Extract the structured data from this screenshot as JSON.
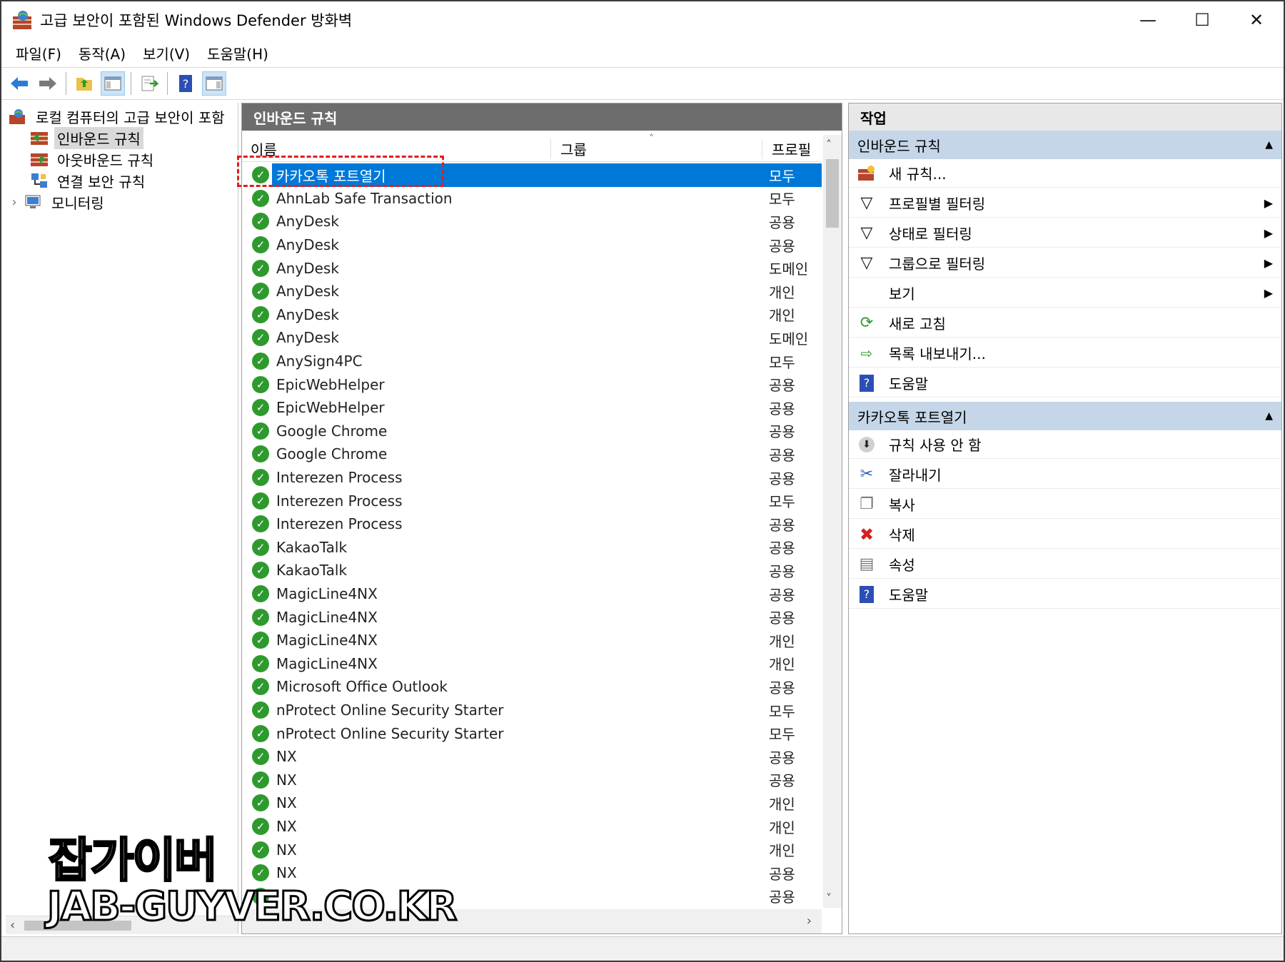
{
  "window": {
    "title": "고급 보안이 포함된 Windows Defender 방화벽",
    "minimize_glyph": "—",
    "maximize_glyph": "☐",
    "close_glyph": "✕"
  },
  "menu": [
    "파일(F)",
    "동작(A)",
    "보기(V)",
    "도움말(H)"
  ],
  "toolbar": {
    "icons": [
      "back-arrow-icon",
      "forward-arrow-icon",
      "up-folder-icon",
      "show-hide-tree-icon",
      "export-list-icon",
      "help-icon",
      "show-hide-action-pane-icon"
    ],
    "question_glyph": "?"
  },
  "tree": {
    "root": "로컬 컴퓨터의 고급 보안이 포함",
    "items": [
      "인바운드 규칙",
      "아웃바운드 규칙",
      "연결 보안 규칙",
      "모니터링"
    ],
    "expander_glyph": "›",
    "left_arrow": "‹"
  },
  "center": {
    "title": "인바운드 규칙",
    "columns": [
      "이름",
      "그룹",
      "프로필"
    ],
    "sort_glyph": "˄",
    "check_glyph": "✓",
    "up_arrow": "˄",
    "down_arrow": "˅",
    "right_arrow": "›",
    "rows": [
      {
        "name": "카카오톡 포트열기",
        "profile": "모두",
        "selected": true
      },
      {
        "name": "AhnLab Safe Transaction",
        "profile": "모두"
      },
      {
        "name": "AnyDesk",
        "profile": "공용"
      },
      {
        "name": "AnyDesk",
        "profile": "공용"
      },
      {
        "name": "AnyDesk",
        "profile": "도메인"
      },
      {
        "name": "AnyDesk",
        "profile": "개인"
      },
      {
        "name": "AnyDesk",
        "profile": "개인"
      },
      {
        "name": "AnyDesk",
        "profile": "도메인"
      },
      {
        "name": "AnySign4PC",
        "profile": "모두"
      },
      {
        "name": "EpicWebHelper",
        "profile": "공용"
      },
      {
        "name": "EpicWebHelper",
        "profile": "공용"
      },
      {
        "name": "Google Chrome",
        "profile": "공용"
      },
      {
        "name": "Google Chrome",
        "profile": "공용"
      },
      {
        "name": "Interezen Process",
        "profile": "공용"
      },
      {
        "name": "Interezen Process",
        "profile": "모두"
      },
      {
        "name": "Interezen Process",
        "profile": "공용"
      },
      {
        "name": "KakaoTalk",
        "profile": "공용"
      },
      {
        "name": "KakaoTalk",
        "profile": "공용"
      },
      {
        "name": "MagicLine4NX",
        "profile": "공용"
      },
      {
        "name": "MagicLine4NX",
        "profile": "공용"
      },
      {
        "name": "MagicLine4NX",
        "profile": "개인"
      },
      {
        "name": "MagicLine4NX",
        "profile": "개인"
      },
      {
        "name": "Microsoft Office Outlook",
        "profile": "공용"
      },
      {
        "name": "nProtect Online Security Starter",
        "profile": "모두"
      },
      {
        "name": "nProtect Online Security Starter",
        "profile": "모두"
      },
      {
        "name": "NX",
        "profile": "공용"
      },
      {
        "name": "NX",
        "profile": "공용"
      },
      {
        "name": "NX",
        "profile": "개인"
      },
      {
        "name": "NX",
        "profile": "개인"
      },
      {
        "name": "NX",
        "profile": "개인"
      },
      {
        "name": "NX",
        "profile": "공용"
      },
      {
        "name": "",
        "profile": "공용"
      }
    ]
  },
  "actions": {
    "title": "작업",
    "collapse_glyph": "▲",
    "submenu_glyph": "▶",
    "sections": [
      {
        "header": "인바운드 규칙",
        "items": [
          {
            "label": "새 규칙...",
            "icon": "new-rule-icon",
            "submenu": false
          },
          {
            "label": "프로필별 필터링",
            "icon": "filter-icon",
            "submenu": true
          },
          {
            "label": "상태로 필터링",
            "icon": "filter-icon",
            "submenu": true
          },
          {
            "label": "그룹으로 필터링",
            "icon": "filter-icon",
            "submenu": true
          },
          {
            "label": "보기",
            "icon": "",
            "submenu": true
          },
          {
            "label": "새로 고침",
            "icon": "refresh-icon",
            "submenu": false
          },
          {
            "label": "목록 내보내기...",
            "icon": "export-list-icon",
            "submenu": false
          },
          {
            "label": "도움말",
            "icon": "help-icon",
            "submenu": false
          }
        ]
      },
      {
        "header": "카카오톡 포트열기",
        "items": [
          {
            "label": "규칙 사용 안 함",
            "icon": "disable-rule-icon",
            "submenu": false
          },
          {
            "label": "잘라내기",
            "icon": "cut-icon",
            "submenu": false
          },
          {
            "label": "복사",
            "icon": "copy-icon",
            "submenu": false
          },
          {
            "label": "삭제",
            "icon": "delete-icon",
            "submenu": false
          },
          {
            "label": "속성",
            "icon": "properties-icon",
            "submenu": false
          },
          {
            "label": "도움말",
            "icon": "help-icon",
            "submenu": false
          }
        ]
      }
    ],
    "glyphs": {
      "filter": "▽",
      "refresh": "⟳",
      "export": "⇨",
      "help": "?",
      "disable": "⬇",
      "cut": "✂",
      "copy": "❐",
      "delete": "✖",
      "properties": "▤"
    }
  },
  "watermark": {
    "line1": "잡가이버",
    "line2": "JAB-GUYVER.CO.KR"
  },
  "colors": {
    "selection": "#0078d7",
    "header_gray": "#6d6d6d",
    "section_blue": "#c5d6e8",
    "check_green": "#2e9a2e",
    "delete_red": "#d42020",
    "help_blue": "#2b4fb5"
  }
}
